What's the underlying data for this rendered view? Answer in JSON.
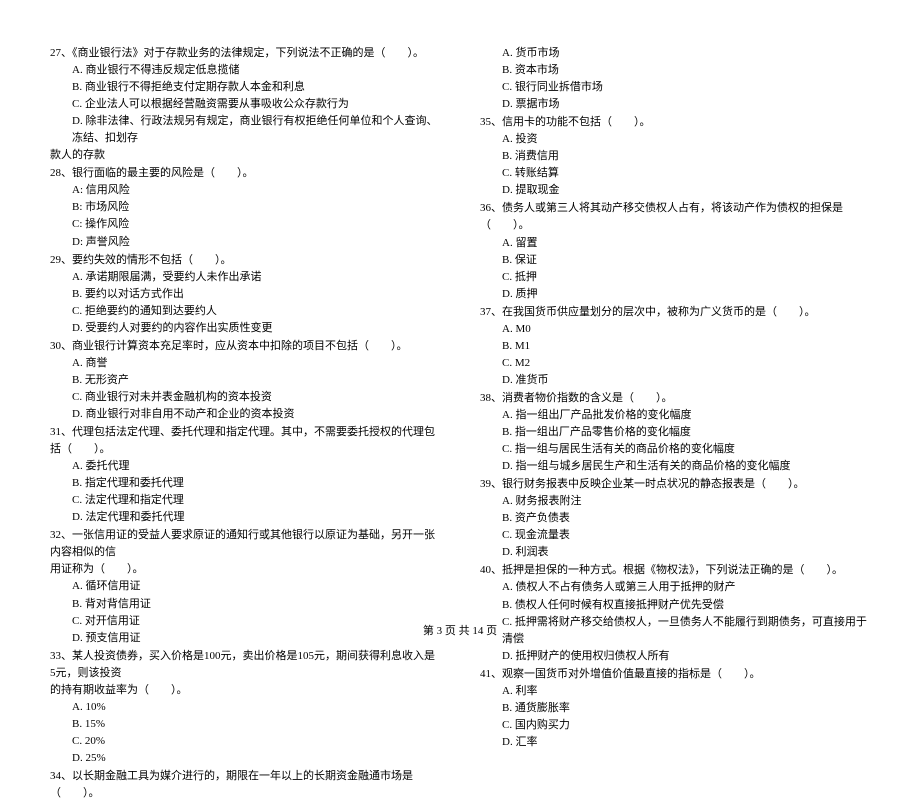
{
  "footer": "第 3 页 共 14 页",
  "left": {
    "q27": {
      "text": "27、《商业银行法》对于存款业务的法律规定，下列说法不正确的是（　　）。",
      "a": "A. 商业银行不得违反规定低息揽储",
      "b": "B. 商业银行不得拒绝支付定期存款人本金和利息",
      "c": "C. 企业法人可以根据经营融资需要从事吸收公众存款行为",
      "d": "D. 除非法律、行政法规另有规定，商业银行有权拒绝任何单位和个人查询、冻结、扣划存",
      "d2": "款人的存款"
    },
    "q28": {
      "text": "28、银行面临的最主要的风险是（　　）。",
      "a": "A: 信用风险",
      "b": "B: 市场风险",
      "c": "C: 操作风险",
      "d": "D: 声誉风险"
    },
    "q29": {
      "text": "29、要约失效的情形不包括（　　）。",
      "a": "A. 承诺期限届满，受要约人未作出承诺",
      "b": "B. 要约以对话方式作出",
      "c": "C. 拒绝要约的通知到达要约人",
      "d": "D. 受要约人对要约的内容作出实质性变更"
    },
    "q30": {
      "text": "30、商业银行计算资本充足率时，应从资本中扣除的项目不包括（　　）。",
      "a": "A. 商誉",
      "b": "B. 无形资产",
      "c": "C. 商业银行对未并表金融机构的资本投资",
      "d": "D. 商业银行对非自用不动产和企业的资本投资"
    },
    "q31": {
      "text": "31、代理包括法定代理、委托代理和指定代理。其中，不需要委托授权的代理包括（　　）。",
      "a": "A. 委托代理",
      "b": "B. 指定代理和委托代理",
      "c": "C. 法定代理和指定代理",
      "d": "D. 法定代理和委托代理"
    },
    "q32": {
      "text": "32、一张信用证的受益人要求原证的通知行或其他银行以原证为基础，另开一张内容相似的信",
      "text2": "用证称为（　　）。",
      "a": "A. 循环信用证",
      "b": "B. 背对背信用证",
      "c": "C. 对开信用证",
      "d": "D. 预支信用证"
    },
    "q33": {
      "text": "33、某人投资债券，买入价格是100元，卖出价格是105元，期间获得利息收入是5元，则该投资",
      "text2": "的持有期收益率为（　　）。",
      "a": "A. 10%",
      "b": "B. 15%",
      "c": "C. 20%",
      "d": "D. 25%"
    },
    "q34": {
      "text": "34、以长期金融工具为媒介进行的，期限在一年以上的长期资金融通市场是（　　）。"
    }
  },
  "right": {
    "q34opts": {
      "a": "A. 货币市场",
      "b": "B. 资本市场",
      "c": "C. 银行同业拆借市场",
      "d": "D. 票据市场"
    },
    "q35": {
      "text": "35、信用卡的功能不包括（　　）。",
      "a": "A. 投资",
      "b": "B. 消费信用",
      "c": "C. 转账结算",
      "d": "D. 提取现金"
    },
    "q36": {
      "text": "36、债务人或第三人将其动产移交债权人占有，将该动产作为债权的担保是（　　）。",
      "a": "A. 留置",
      "b": "B. 保证",
      "c": "C. 抵押",
      "d": "D. 质押"
    },
    "q37": {
      "text": "37、在我国货币供应量划分的层次中，被称为广义货币的是（　　）。",
      "a": "A. M0",
      "b": "B. M1",
      "c": "C. M2",
      "d": "D. 准货币"
    },
    "q38": {
      "text": "38、消费者物价指数的含义是（　　）。",
      "a": "A. 指一组出厂产品批发价格的变化幅度",
      "b": "B. 指一组出厂产品零售价格的变化幅度",
      "c": "C. 指一组与居民生活有关的商品价格的变化幅度",
      "d": "D. 指一组与城乡居民生产和生活有关的商品价格的变化幅度"
    },
    "q39": {
      "text": "39、银行财务报表中反映企业某一时点状况的静态报表是（　　）。",
      "a": "A. 财务报表附注",
      "b": "B. 资产负债表",
      "c": "C. 现金流量表",
      "d": "D. 利润表"
    },
    "q40": {
      "text": "40、抵押是担保的一种方式。根据《物权法》，下列说法正确的是（　　）。",
      "a": "A. 债权人不占有债务人或第三人用于抵押的财产",
      "b": "B. 债权人任何时候有权直接抵押财产优先受偿",
      "c": "C. 抵押需将财产移交给债权人，一旦债务人不能履行到期债务，可直接用于清偿",
      "d": "D. 抵押财产的使用权归债权人所有"
    },
    "q41": {
      "text": "41、观察一国货币对外增值价值最直接的指标是（　　）。",
      "a": "A. 利率",
      "b": "B. 通货膨胀率",
      "c": "C. 国内购买力",
      "d": "D. 汇率"
    }
  }
}
